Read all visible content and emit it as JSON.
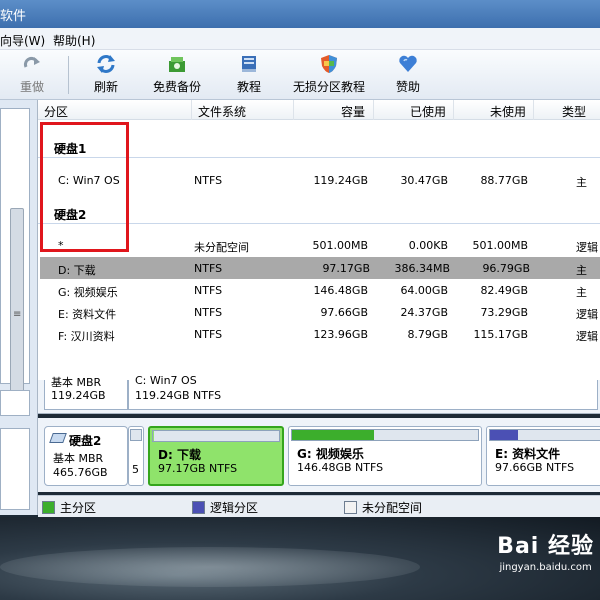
{
  "window": {
    "title": "软件"
  },
  "menu": {
    "items": [
      "向导(W)",
      "帮助(H)"
    ]
  },
  "toolbar": {
    "buttons": [
      {
        "label": "重做",
        "icon": "redo-icon",
        "disabled": true
      },
      {
        "label": "刷新",
        "icon": "refresh-icon"
      },
      {
        "label": "免费备份",
        "icon": "backup-icon"
      },
      {
        "label": "教程",
        "icon": "book-icon"
      },
      {
        "label": "无损分区教程",
        "icon": "shield-icon"
      },
      {
        "label": "赞助",
        "icon": "heart-icon"
      }
    ]
  },
  "table": {
    "headers": [
      "分区",
      "文件系统",
      "容量",
      "已使用",
      "未使用",
      "类型"
    ],
    "groups": [
      {
        "label": "硬盘1",
        "rows": [
          {
            "name": "C: Win7 OS",
            "fs": "NTFS",
            "capacity": "119.24GB",
            "used": "30.47GB",
            "free": "88.77GB",
            "type": "主"
          }
        ]
      },
      {
        "label": "硬盘2",
        "rows": [
          {
            "name": "*",
            "fs": "未分配空间",
            "capacity": "501.00MB",
            "used": "0.00KB",
            "free": "501.00MB",
            "type": "逻辑"
          },
          {
            "name": "D: 下载",
            "fs": "NTFS",
            "capacity": "97.17GB",
            "used": "386.34MB",
            "free": "96.79GB",
            "type": "主",
            "selected": true
          },
          {
            "name": "G: 视频娱乐",
            "fs": "NTFS",
            "capacity": "146.48GB",
            "used": "64.00GB",
            "free": "82.49GB",
            "type": "主"
          },
          {
            "name": "E: 资料文件",
            "fs": "NTFS",
            "capacity": "97.66GB",
            "used": "24.37GB",
            "free": "73.29GB",
            "type": "逻辑"
          },
          {
            "name": "F: 汉川资料",
            "fs": "NTFS",
            "capacity": "123.96GB",
            "used": "8.79GB",
            "free": "115.17GB",
            "type": "逻辑"
          }
        ]
      }
    ]
  },
  "disk1_map": {
    "info_line1": "基本 MBR",
    "info_line2": "119.24GB",
    "part_line1": "C: Win7 OS",
    "part_line2": "119.24GB NTFS"
  },
  "disk2_map": {
    "name": "硬盘2",
    "type": "基本 MBR",
    "size": "465.76GB",
    "unalloc_label": "5",
    "blocks": [
      {
        "name": "D: 下载",
        "size": "97.17GB NTFS",
        "usage": 0.004,
        "color": "#8fe36b"
      },
      {
        "name": "G: 视频娱乐",
        "size": "146.48GB NTFS",
        "usage": 0.44,
        "color": "#3cae2c"
      },
      {
        "name": "E: 资料文件",
        "size": "97.66GB NTFS",
        "usage": 0.25,
        "color": "#4b50b4"
      }
    ]
  },
  "legend": [
    {
      "label": "主分区",
      "color": "#3cae2c"
    },
    {
      "label": "逻辑分区",
      "color": "#4b50b4"
    },
    {
      "label": "未分配空间",
      "color": "#f2f2f2"
    }
  ],
  "watermark": {
    "logo": "Bai 经验",
    "url": "jingyan.baidu.com"
  }
}
